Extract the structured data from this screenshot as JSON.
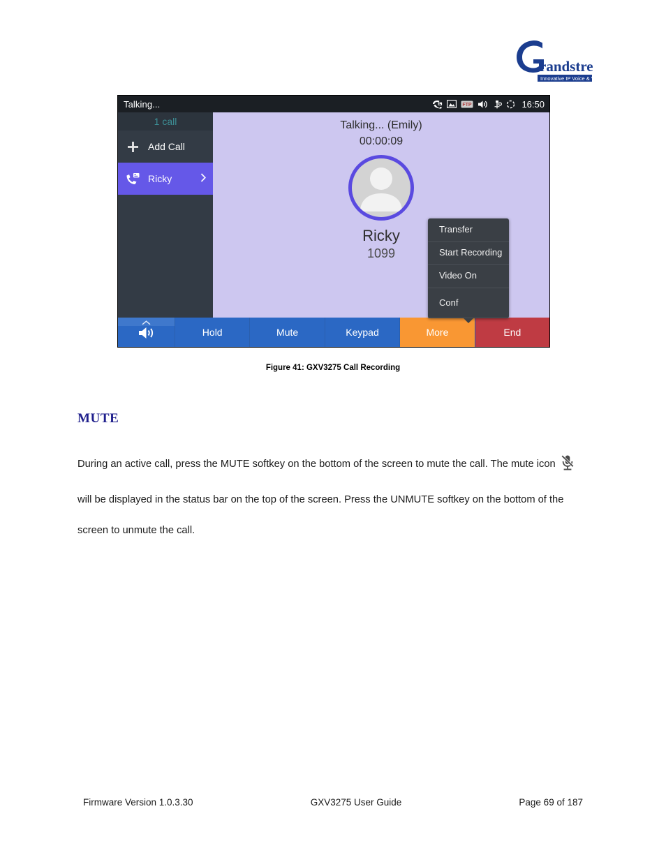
{
  "logo": {
    "name": "Grandstream",
    "wordmark": "randstream",
    "tagline": "Innovative IP Voice & Video",
    "color": "#1b3d8f"
  },
  "screenshot": {
    "status_bar": {
      "title": "Talking...",
      "clock": "16:50",
      "icons": [
        "call-missed-icon",
        "image-icon",
        "ftp-icon",
        "speaker-icon",
        "usb-icon",
        "sync-icon"
      ],
      "ftp_label": "FTP"
    },
    "sidebar": {
      "call_count": "1 call",
      "add_call_label": "Add Call",
      "add_call_icon": "plus-icon",
      "active_call": {
        "name": "Ricky",
        "icon": "call-active-icon",
        "chevron": "chevron-right-icon"
      }
    },
    "call": {
      "status": "Talking... (Emily)",
      "timer": "00:00:09",
      "name": "Ricky",
      "number": "1099",
      "avatar_icon": "person-avatar-icon"
    },
    "popup_menu": {
      "items": [
        {
          "label": "Transfer"
        },
        {
          "label": "Start Recording"
        },
        {
          "label": "Video On"
        },
        {
          "label": "Conf"
        }
      ]
    },
    "softkeys": {
      "speaker": {
        "icon": "speaker-icon",
        "expand_icon": "chevron-up-icon"
      },
      "hold": "Hold",
      "mute": "Mute",
      "keypad": "Keypad",
      "more": "More",
      "end": "End"
    },
    "colors": {
      "accent_purple": "#6558e8",
      "panel_lavender": "#cdc7f0",
      "sidebar_dark": "#333b45",
      "status_dark": "#1b1f24",
      "softkey_blue": "#2b68c4",
      "more_orange": "#f99733",
      "end_red": "#bf3b43",
      "call_count_teal": "#3d8f96"
    }
  },
  "figure": {
    "caption": "Figure 41: GXV3275 Call Recording"
  },
  "section": {
    "heading": "MUTE",
    "paragraph_part1": "During an active call, press the MUTE softkey on the bottom of the screen to mute the call. The mute icon",
    "mute_icon": "mute-microphone-icon",
    "paragraph_part2": "will be displayed in the status bar on the top of the screen. Press the UNMUTE softkey on the bottom of the screen to unmute the call."
  },
  "footer": {
    "firmware": "Firmware Version 1.0.3.30",
    "guide": "GXV3275 User Guide",
    "page": "Page 69 of 187"
  }
}
